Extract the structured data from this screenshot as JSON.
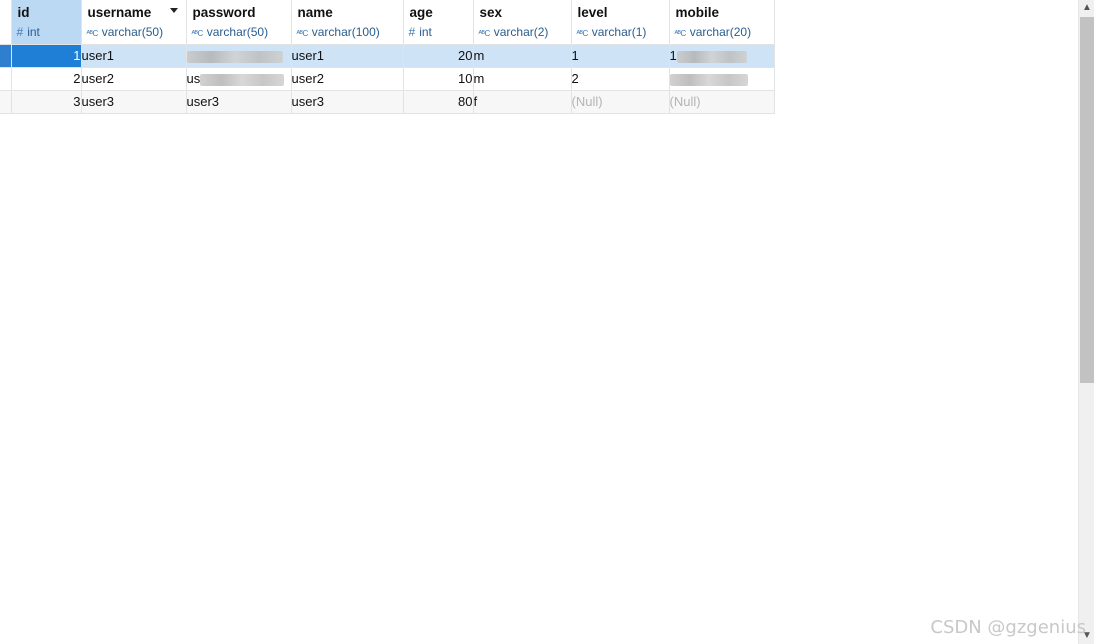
{
  "columns": [
    {
      "name": "id",
      "type": "int",
      "icon": "hash-icon"
    },
    {
      "name": "username",
      "type": "varchar(50)",
      "icon": "abc-icon"
    },
    {
      "name": "password",
      "type": "varchar(50)",
      "icon": "abc-icon"
    },
    {
      "name": "name",
      "type": "varchar(100)",
      "icon": "abc-icon"
    },
    {
      "name": "age",
      "type": "int",
      "icon": "hash-icon"
    },
    {
      "name": "sex",
      "type": "varchar(2)",
      "icon": "abc-icon"
    },
    {
      "name": "level",
      "type": "varchar(1)",
      "icon": "abc-icon"
    },
    {
      "name": "mobile",
      "type": "varchar(20)",
      "icon": "abc-icon"
    }
  ],
  "icons": {
    "hash": "#",
    "abc": "ᴬᴮC"
  },
  "rows": [
    {
      "id": "1",
      "username": "user1",
      "password": "",
      "name": "user1",
      "age": "20",
      "sex": "m",
      "level": "1",
      "mobile": "1"
    },
    {
      "id": "2",
      "username": "user2",
      "password": "us",
      "name": "user2",
      "age": "10",
      "sex": "m",
      "level": "2",
      "mobile": ""
    },
    {
      "id": "3",
      "username": "user3",
      "password": "user3",
      "name": "user3",
      "age": "80",
      "sex": "f",
      "level": "(Null)",
      "mobile": "(Null)"
    }
  ],
  "scrollbar": {
    "up": "▲",
    "down": "▼"
  },
  "watermark": "CSDN @gzgenius",
  "colors": {
    "selected_row": "#cfe3f6",
    "selected_cell": "#1f7fd6",
    "selected_header": "#bcd9f4",
    "type_text": "#2a5d8f",
    "null_text": "#b4b4b4"
  }
}
